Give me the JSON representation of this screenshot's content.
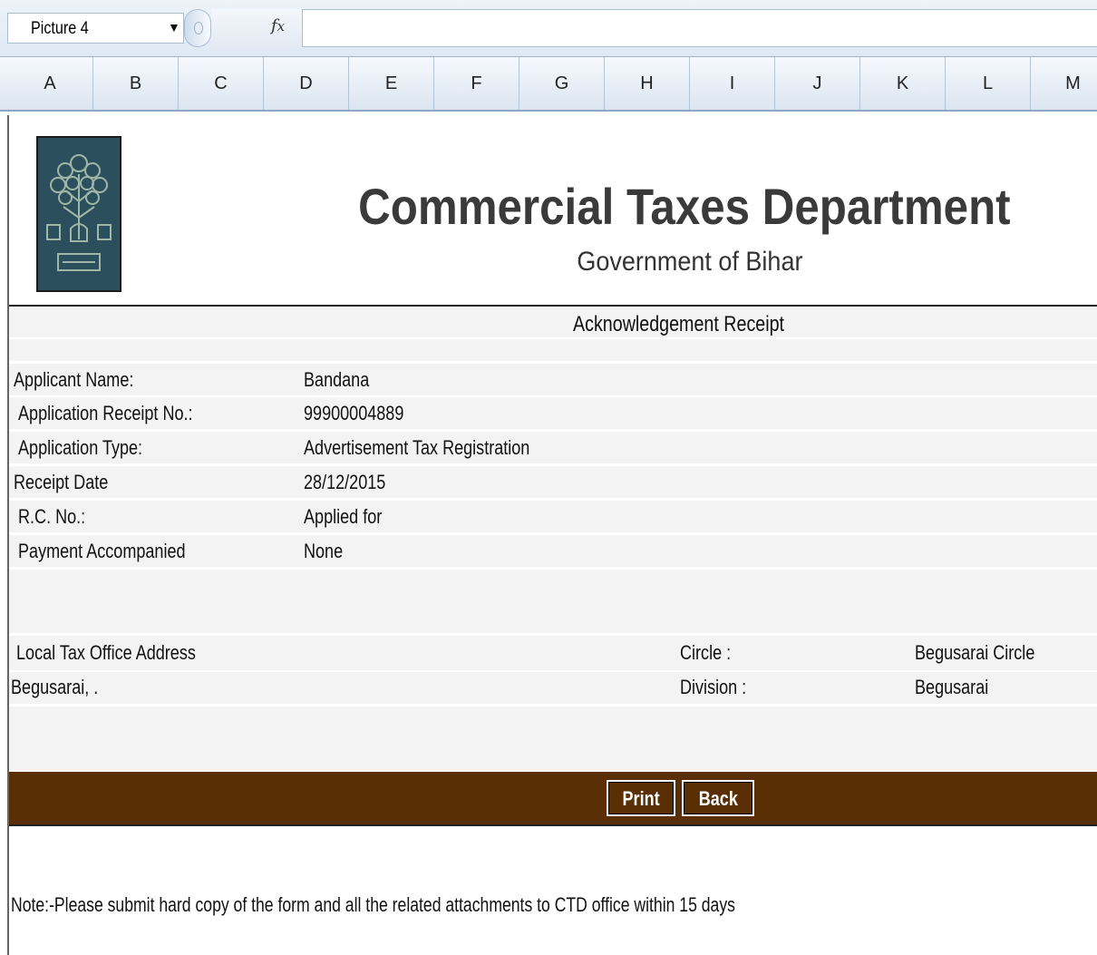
{
  "formula_bar": {
    "name_box": "Picture 4",
    "fx_label": "fx"
  },
  "columns": [
    "A",
    "B",
    "C",
    "D",
    "E",
    "F",
    "G",
    "H",
    "I",
    "J",
    "K",
    "L",
    "M"
  ],
  "header": {
    "title": "Commercial Taxes Department",
    "subtitle": "Government of Bihar"
  },
  "receipt": {
    "title": "Acknowledgement Receipt",
    "fields": [
      {
        "label": "Applicant Name:",
        "value": "Bandana"
      },
      {
        "label": "Application Receipt No.:",
        "value": "99900004889"
      },
      {
        "label": "Application Type:",
        "value": "Advertisement Tax Registration"
      },
      {
        "label": "Receipt Date",
        "value": "28/12/2015"
      },
      {
        "label": "R.C. No.:",
        "value": "Applied for"
      },
      {
        "label": "Payment Accompanied",
        "value": "None"
      }
    ],
    "office": {
      "address_label": "Local Tax Office Address",
      "address_value": "Begusarai, .",
      "circle_label": "Circle :",
      "circle_value": "Begusarai Circle",
      "division_label": "Division :",
      "division_value": "Begusarai"
    }
  },
  "actions": {
    "print_label": "Print",
    "back_label": "Back"
  },
  "note": "Note:-Please submit hard copy of the form and all the related attachments to CTD office within 15 days",
  "colors": {
    "action_bar": "#5a2f06",
    "logo_bg": "#2c4f5d"
  }
}
